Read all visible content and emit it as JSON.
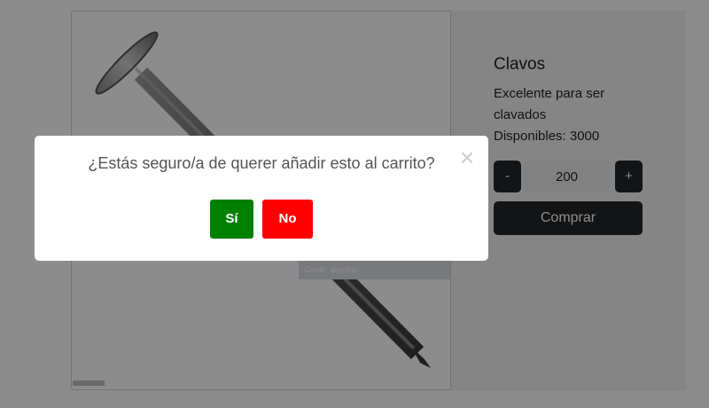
{
  "product": {
    "title": "Clavos",
    "description": "Excelente para ser clavados",
    "stock_label": "Disponibles: 3000",
    "quantity": "200",
    "minus_label": "-",
    "plus_label": "+",
    "buy_label": "Comprar",
    "image_credit": "Credit: akinshin",
    "image_brand": "iStock"
  },
  "modal": {
    "question": "¿Estás seguro/a de querer añadir esto al carrito?",
    "yes_label": "Sí",
    "no_label": "No",
    "close_icon": "×"
  },
  "colors": {
    "yes": "#008000",
    "no": "#ff0000",
    "dark_button": "#212529",
    "backdrop": "rgba(0,0,0,0.45)"
  }
}
